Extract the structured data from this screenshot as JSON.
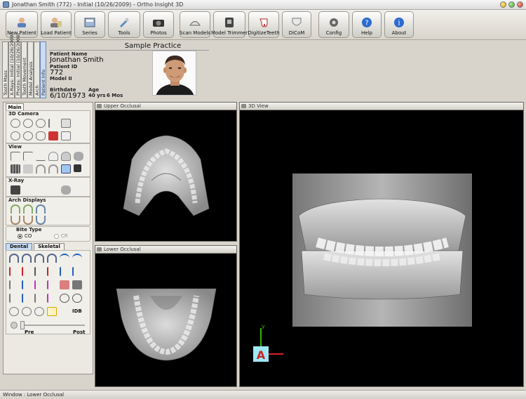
{
  "window": {
    "title": "Jonathan Smith (772) - Initial (10/26/2009) - Ortho Insight 3D"
  },
  "toolbar": {
    "buttons": [
      {
        "id": "new-patient",
        "label": "New Patient"
      },
      {
        "id": "load-patient",
        "label": "Load Patient"
      },
      {
        "id": "series",
        "label": "Series"
      },
      {
        "id": "tools",
        "label": "Tools"
      },
      {
        "id": "photos",
        "label": "Photos"
      },
      {
        "id": "scan-models",
        "label": "Scan Models"
      },
      {
        "id": "model-trimmer",
        "label": "Model Trimmer"
      },
      {
        "id": "digitize-teeth",
        "label": "DigitizeTeeth"
      },
      {
        "id": "dicom",
        "label": "DiCoM"
      },
      {
        "id": "config",
        "label": "Config"
      },
      {
        "id": "help",
        "label": "Help"
      },
      {
        "id": "about",
        "label": "About"
      }
    ]
  },
  "side_tabs": [
    "Tooth Mass",
    "X-Rays: Initial (10/26/2009)",
    "Photos: Initial (10/26/2009)",
    "Tooth Movement",
    "Model Analysis",
    "Arch",
    "Patient Info"
  ],
  "patient": {
    "practice": "Sample Practice",
    "name_label": "Patient Name",
    "name": "Jonathan Smith",
    "id_label": "Patient ID",
    "id": "772",
    "model_label": "Model II",
    "birthdate_label": "Birthdate",
    "birthdate": "6/10/1973",
    "age_label": "Age",
    "age_years": "40 yrs",
    "age_months": "6 Mos"
  },
  "left_panel": {
    "main_tab": "Main",
    "sections": {
      "camera": "3D Camera",
      "view": "View",
      "xray": "X-Ray",
      "arch": "Arch Displays",
      "bite": "Bite Type"
    },
    "bite_options": [
      "CO",
      "CR"
    ],
    "bite_selected": "CO",
    "tx_tabs": [
      "Dental Tx",
      "Skeletal Tx"
    ],
    "idb_label": "IDB",
    "slider_pre": "Pre",
    "slider_post": "Post",
    "slider_position": 0.0
  },
  "viewports": {
    "upper": "Upper Occlusal",
    "lower": "Lower Occlusal",
    "threed": "3D View",
    "axis_y": "y"
  },
  "status": {
    "text": "Window : Lower Occlusal"
  }
}
